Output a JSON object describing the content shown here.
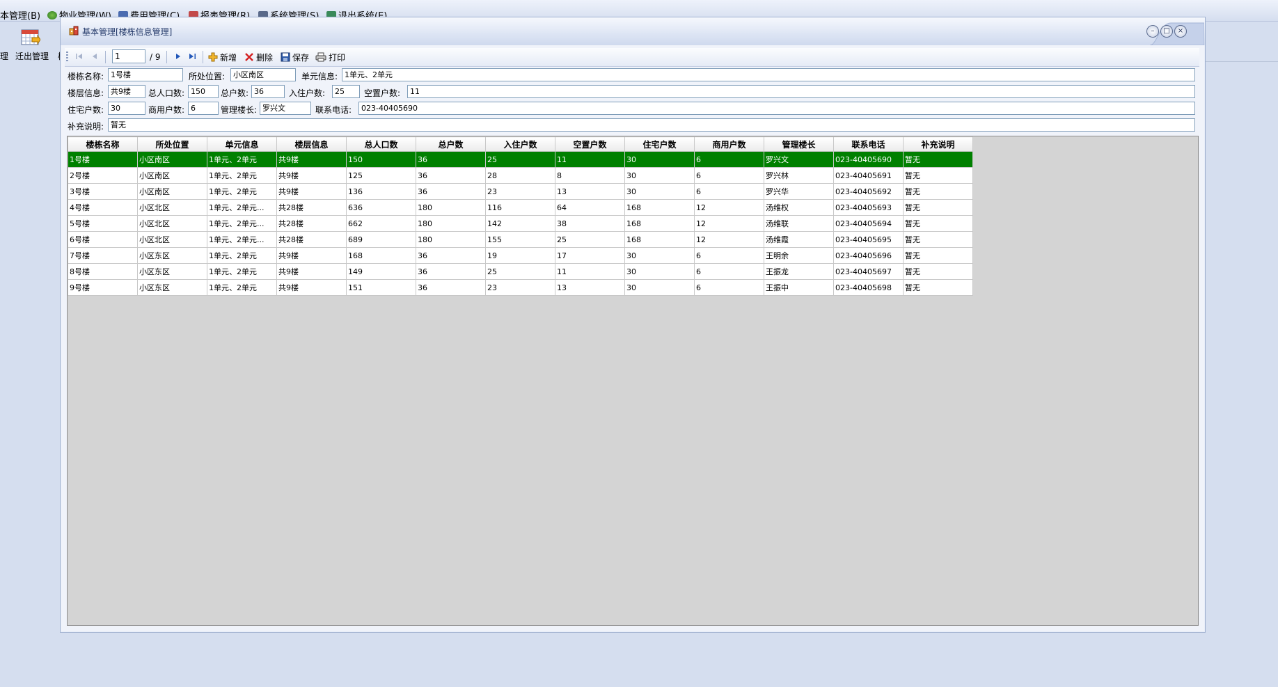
{
  "app": {
    "menus": [
      {
        "label": "本管理(B)"
      },
      {
        "label": "物业管理(W)"
      },
      {
        "label": "费用管理(C)"
      },
      {
        "label": "报表管理(R)"
      },
      {
        "label": "系统管理(S)"
      },
      {
        "label": "退出系统(E)"
      }
    ],
    "tool_left_label": "理",
    "tool_label": "迁出管理",
    "tool_right_label": "楼"
  },
  "window": {
    "title": "基本管理[楼栋信息管理]",
    "minimize": "–",
    "maximize": "□",
    "close": "×"
  },
  "toolbar": {
    "position": "1",
    "total": "/ 9",
    "add": "新增",
    "delete": "删除",
    "save": "保存",
    "print": "打印"
  },
  "form": {
    "building_name": {
      "label": "楼栋名称:",
      "value": "1号楼"
    },
    "location": {
      "label": "所处位置:",
      "value": "小区南区"
    },
    "unit_info": {
      "label": "单元信息:",
      "value": "1单元、2单元"
    },
    "floor_info": {
      "label": "楼层信息:",
      "value": "共9楼"
    },
    "population": {
      "label": "总人口数:",
      "value": "150"
    },
    "households": {
      "label": "总户数:",
      "value": "36"
    },
    "occupied": {
      "label": "入住户数:",
      "value": "25"
    },
    "vacant": {
      "label": "空置户数:",
      "value": "11"
    },
    "residential": {
      "label": "住宅户数:",
      "value": "30"
    },
    "commercial": {
      "label": "商用户数:",
      "value": "6"
    },
    "manager": {
      "label": "管理楼长:",
      "value": "罗兴文"
    },
    "phone": {
      "label": "联系电话:",
      "value": "023-40405690"
    },
    "remark": {
      "label": "补充说明:",
      "value": "暂无"
    }
  },
  "grid": {
    "columns": [
      "楼栋名称",
      "所处位置",
      "单元信息",
      "楼层信息",
      "总人口数",
      "总户数",
      "入住户数",
      "空置户数",
      "住宅户数",
      "商用户数",
      "管理楼长",
      "联系电话",
      "补充说明"
    ],
    "rows": [
      [
        "1号楼",
        "小区南区",
        "1单元、2单元",
        "共9楼",
        "150",
        "36",
        "25",
        "11",
        "30",
        "6",
        "罗兴文",
        "023-40405690",
        "暂无"
      ],
      [
        "2号楼",
        "小区南区",
        "1单元、2单元",
        "共9楼",
        "125",
        "36",
        "28",
        "8",
        "30",
        "6",
        "罗兴林",
        "023-40405691",
        "暂无"
      ],
      [
        "3号楼",
        "小区南区",
        "1单元、2单元",
        "共9楼",
        "136",
        "36",
        "23",
        "13",
        "30",
        "6",
        "罗兴华",
        "023-40405692",
        "暂无"
      ],
      [
        "4号楼",
        "小区北区",
        "1单元、2单元...",
        "共28楼",
        "636",
        "180",
        "116",
        "64",
        "168",
        "12",
        "汤维权",
        "023-40405693",
        "暂无"
      ],
      [
        "5号楼",
        "小区北区",
        "1单元、2单元...",
        "共28楼",
        "662",
        "180",
        "142",
        "38",
        "168",
        "12",
        "汤维联",
        "023-40405694",
        "暂无"
      ],
      [
        "6号楼",
        "小区北区",
        "1单元、2单元...",
        "共28楼",
        "689",
        "180",
        "155",
        "25",
        "168",
        "12",
        "汤维霞",
        "023-40405695",
        "暂无"
      ],
      [
        "7号楼",
        "小区东区",
        "1单元、2单元",
        "共9楼",
        "168",
        "36",
        "19",
        "17",
        "30",
        "6",
        "王明余",
        "023-40405696",
        "暂无"
      ],
      [
        "8号楼",
        "小区东区",
        "1单元、2单元",
        "共9楼",
        "149",
        "36",
        "25",
        "11",
        "30",
        "6",
        "王振龙",
        "023-40405697",
        "暂无"
      ],
      [
        "9号楼",
        "小区东区",
        "1单元、2单元",
        "共9楼",
        "151",
        "36",
        "23",
        "13",
        "30",
        "6",
        "王振中",
        "023-40405698",
        "暂无"
      ]
    ],
    "selected_row": 0,
    "selected_color": "#008000"
  }
}
